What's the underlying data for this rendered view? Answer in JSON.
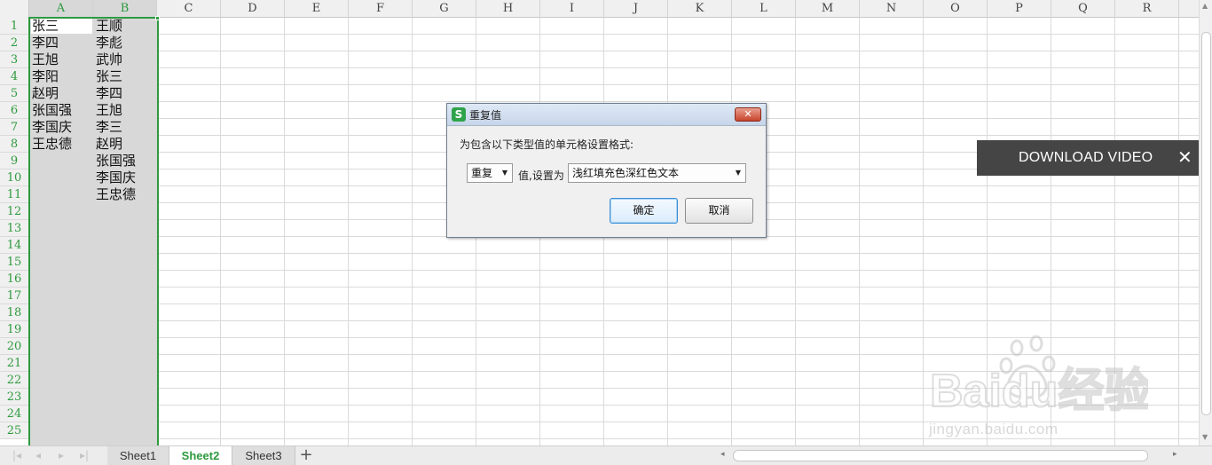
{
  "spreadsheet": {
    "columns": [
      "A",
      "B",
      "C",
      "D",
      "E",
      "F",
      "G",
      "H",
      "I",
      "J",
      "K",
      "L",
      "M",
      "N",
      "O",
      "P",
      "Q",
      "R"
    ],
    "rows": [
      "1",
      "2",
      "3",
      "4",
      "5",
      "6",
      "7",
      "8",
      "9",
      "10",
      "11",
      "12",
      "13",
      "14",
      "15",
      "16",
      "17",
      "18",
      "19",
      "20",
      "21",
      "22",
      "23",
      "24",
      "25"
    ],
    "col_a": [
      "张三",
      "李四",
      "王旭",
      "李阳",
      "赵明",
      "张国强",
      "李国庆",
      "王忠德"
    ],
    "col_b": [
      "王顺",
      "李彪",
      "武帅",
      "张三",
      "李四",
      "王旭",
      "李三",
      "赵明",
      "张国强",
      "李国庆",
      "王忠德"
    ]
  },
  "dialog": {
    "title": "重复值",
    "icon": "S",
    "close": "✕",
    "prompt": "为包含以下类型值的单元格设置格式:",
    "type_value": "重复",
    "mid_text": "值,设置为",
    "format_value": "浅红填充色深红色文本",
    "ok_label": "确定",
    "cancel_label": "取消"
  },
  "sheets": {
    "tabs": [
      "Sheet1",
      "Sheet2",
      "Sheet3"
    ],
    "active": "Sheet2",
    "add": "+"
  },
  "overlay": {
    "download_label": "DOWNLOAD VIDEO",
    "close": "✕"
  },
  "watermark": {
    "brand": "Baidu经验",
    "url": "jingyan.baidu.com"
  },
  "colors": {
    "accent": "#2e9a3e",
    "selection": "#d8d8d8",
    "banner": "#454545"
  },
  "icons": {
    "first_sheet": "first-sheet-icon",
    "prev_sheet": "prev-sheet-icon",
    "next_sheet": "next-sheet-icon",
    "last_sheet": "last-sheet-icon"
  }
}
